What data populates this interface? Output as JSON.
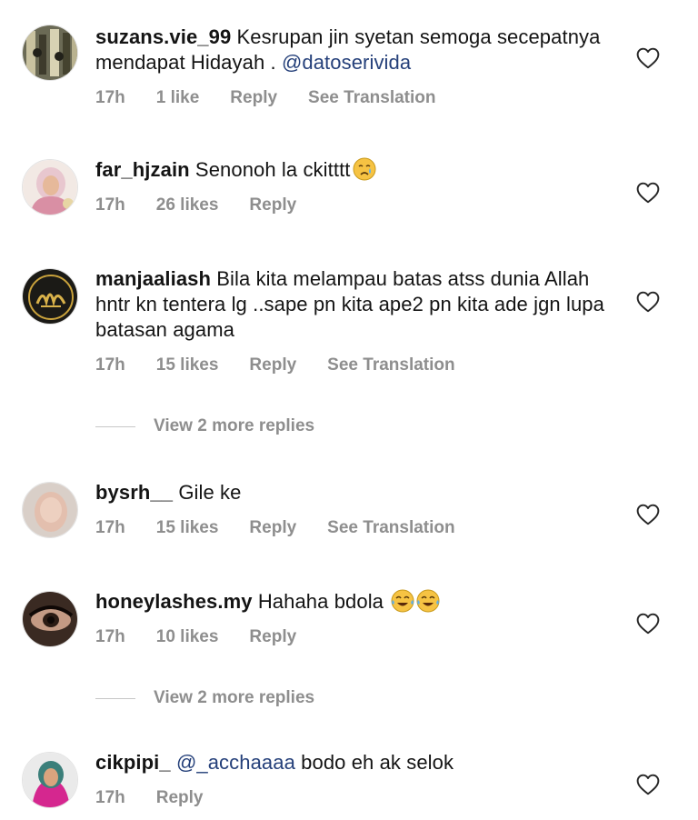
{
  "comments": [
    {
      "username": "suzans.vie_99",
      "text": "Kesrupan jin syetan semoga secepatnya mendapat Hidayah .",
      "mention": "@datoserivida",
      "time": "17h",
      "likes": "1 like",
      "reply": "Reply",
      "translate": "See Translation"
    },
    {
      "username": "far_hjzain",
      "text": "Senonoh la ckitttt",
      "time": "17h",
      "likes": "26 likes",
      "reply": "Reply"
    },
    {
      "username": "manjaaliash",
      "text": "Bila kita melampau batas atss dunia Allah hntr kn tentera lg ..sape pn kita ape2 pn kita ade jgn lupa batasan agama",
      "time": "17h",
      "likes": "15 likes",
      "reply": "Reply",
      "translate": "See Translation"
    },
    {
      "username": "bysrh__",
      "text": "Gile ke",
      "time": "17h",
      "likes": "15 likes",
      "reply": "Reply",
      "translate": "See Translation"
    },
    {
      "username": "honeylashes.my",
      "text": "Hahaha bdola",
      "time": "17h",
      "likes": "10 likes",
      "reply": "Reply"
    },
    {
      "username": "cikpipi_",
      "mention": "@_acchaaaa",
      "text": " bodo eh ak selok",
      "time": "17h",
      "reply": "Reply"
    }
  ],
  "more_replies": [
    "View 2 more replies",
    "View 2 more replies"
  ],
  "colors": {
    "meta": "#8e8e8e",
    "mention": "#25407a"
  },
  "icons": {
    "like": "heart-outline-icon",
    "emoji_cry": "crying-face-emoji",
    "emoji_laugh": "tears-of-joy-emoji"
  }
}
